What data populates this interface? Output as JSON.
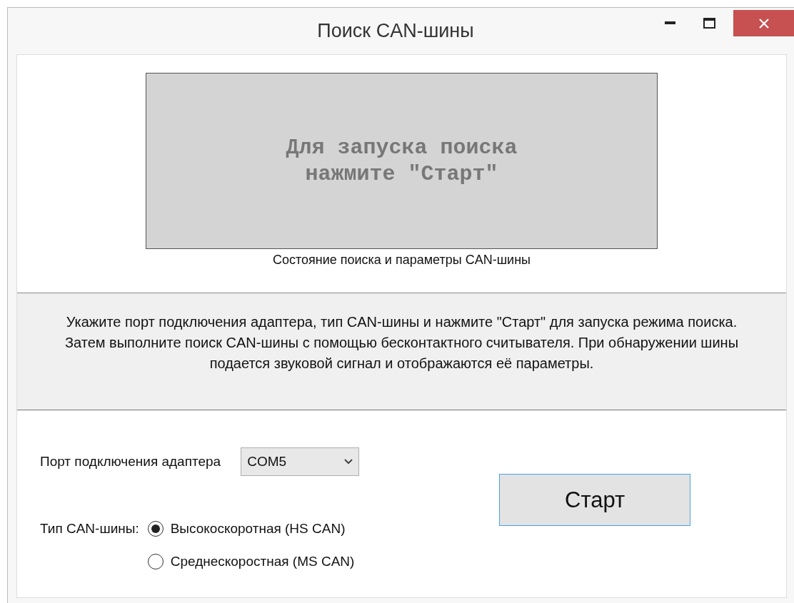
{
  "window": {
    "title": "Поиск CAN-шины"
  },
  "display": {
    "message": "Для запуска поиска\nнажмите \"Старт\"",
    "caption": "Состояние поиска и параметры CAN-шины"
  },
  "instructions": "Укажите порт подключения адаптера, тип CAN-шины и нажмите \"Старт\" для запуска режима поиска. Затем выполните поиск CAN-шины с помощью бесконтактного считывателя. При обнаружении шины подается звуковой сигнал и отображаются её параметры.",
  "port": {
    "label": "Порт подключения адаптера",
    "value": "COM5"
  },
  "bus_type": {
    "label": "Тип CAN-шины:",
    "options": [
      {
        "label": "Высокоскоротная (HS CAN)",
        "selected": true
      },
      {
        "label": "Среднескоростная (MS CAN)",
        "selected": false
      }
    ]
  },
  "start_button": {
    "label": "Старт"
  }
}
